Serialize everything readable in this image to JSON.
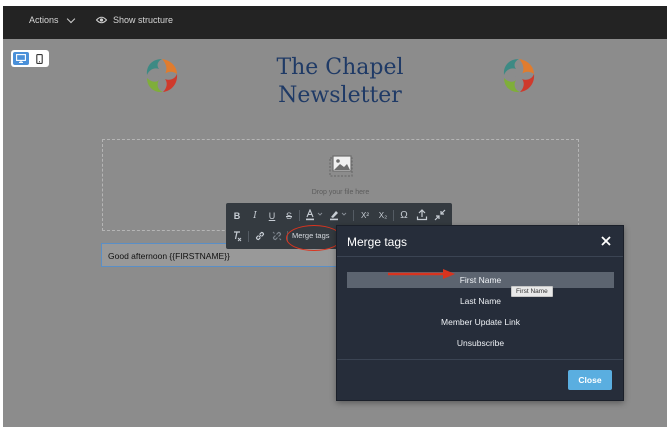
{
  "topbar": {
    "actions_label": "Actions",
    "show_structure_label": "Show structure"
  },
  "device_toggle": {
    "icons": [
      "desktop-icon",
      "mobile-icon"
    ],
    "active": "desktop"
  },
  "newsletter": {
    "title_line1": "The Chapel",
    "title_line2": "Newsletter",
    "drop_text": "Drop your file here",
    "greeting": "Good afternoon {{FIRSTNAME}}"
  },
  "toolbar": {
    "bold": "B",
    "italic": "I",
    "underline": "U",
    "strike": "S",
    "superscript": "X²",
    "subscript": "X₂",
    "special_char": "Ω",
    "merge_tags_label": "Merge tags"
  },
  "modal": {
    "title": "Merge tags",
    "items": [
      "First Name",
      "Last Name",
      "Member Update Link",
      "Unsubscribe"
    ],
    "tooltip": "First Name",
    "close_label": "Close"
  },
  "colors": {
    "topbar": "#232323",
    "canvas": "#8c8c8c",
    "title": "#1f3a66",
    "modal_bg": "#262d3a",
    "close_button": "#5aaee0",
    "annotation": "#d9341f"
  }
}
